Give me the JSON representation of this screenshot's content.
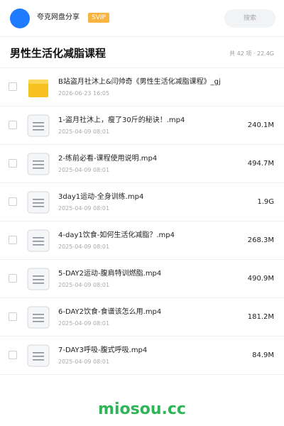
{
  "header": {
    "brand": "夸克网盘分享",
    "badge": "SVIP",
    "search_placeholder": "搜索"
  },
  "title": "男性生活化减脂课程",
  "summary": "共 42 项 · 22.4G",
  "folder": {
    "name": "B站盗月社沐上&闫帅奇《男性生活化减脂课程》_gj",
    "date": "2026-06-23 16:05"
  },
  "files": [
    {
      "name": "1-盗月社沐上，瘦了30斤的秘诀！.mp4",
      "date": "2025-04-09 08:01",
      "size": "240.1M"
    },
    {
      "name": "2-练前必看-课程使用说明.mp4",
      "date": "2025-04-09 08:01",
      "size": "494.7M"
    },
    {
      "name": "3day1运动-全身训练.mp4",
      "date": "2025-04-09 08:01",
      "size": "1.9G"
    },
    {
      "name": "4-day1饮食-如何生活化减脂？.mp4",
      "date": "2025-04-09 08:01",
      "size": "268.3M"
    },
    {
      "name": "5-DAY2运动-腹肩特训燃脂.mp4",
      "date": "2025-04-09 08:01",
      "size": "490.9M"
    },
    {
      "name": "6-DAY2饮食-食谱该怎么用.mp4",
      "date": "2025-04-09 08:01",
      "size": "181.2M"
    },
    {
      "name": "7-DAY3呼吸-腹式呼吸.mp4",
      "date": "2025-04-09 08:01",
      "size": "84.9M"
    }
  ],
  "watermark": "miosou.cc",
  "colors": {
    "accent": "#1e7bff",
    "svip": "#f9b340",
    "folder": "#f7c21f",
    "watermark": "#2fb457"
  }
}
